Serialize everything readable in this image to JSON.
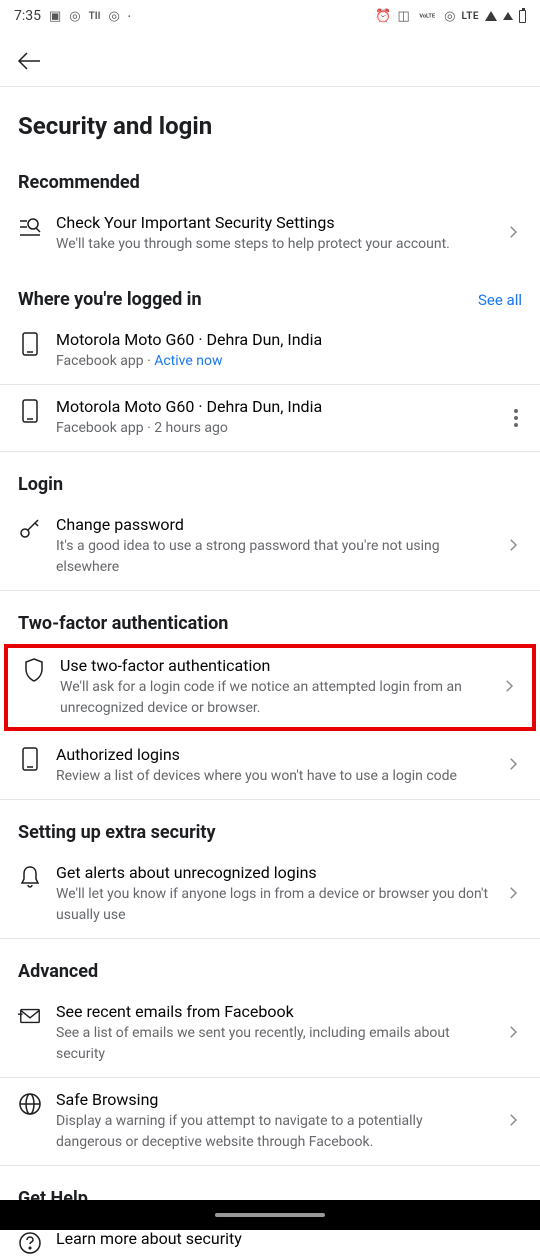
{
  "status": {
    "time": "7:35",
    "lte": "LTE",
    "volte": "VoLTE"
  },
  "header": {
    "title": "Security and login"
  },
  "sections": {
    "recommended": {
      "title": "Recommended",
      "item": {
        "title": "Check Your Important Security Settings",
        "subtitle": "We'll take you through some steps to help protect your account."
      }
    },
    "logged_in": {
      "title": "Where you're logged in",
      "see_all": "See all",
      "items": [
        {
          "title": "Motorola Moto G60 · Dehra Dun, India",
          "app": "Facebook app · ",
          "status": "Active now"
        },
        {
          "title": "Motorola Moto G60 · Dehra Dun, India",
          "subtitle": "Facebook app · 2 hours ago"
        }
      ]
    },
    "login": {
      "title": "Login",
      "item": {
        "title": "Change password",
        "subtitle": "It's a good idea to use a strong password that you're not using elsewhere"
      }
    },
    "two_factor": {
      "title": "Two-factor authentication",
      "items": [
        {
          "title": "Use two-factor authentication",
          "subtitle": "We'll ask for a login code if we notice an attempted login from an unrecognized device or browser."
        },
        {
          "title": "Authorized logins",
          "subtitle": "Review a list of devices where you won't have to use a login code"
        }
      ]
    },
    "extra_security": {
      "title": "Setting up extra security",
      "item": {
        "title": "Get alerts about unrecognized logins",
        "subtitle": "We'll let you know if anyone logs in from a device or browser you don't usually use"
      }
    },
    "advanced": {
      "title": "Advanced",
      "items": [
        {
          "title": "See recent emails from Facebook",
          "subtitle": "See a list of emails we sent you recently, including emails about security"
        },
        {
          "title": "Safe Browsing",
          "subtitle": "Display a warning if you attempt to navigate to a potentially dangerous or deceptive website through Facebook."
        }
      ]
    },
    "get_help": {
      "title": "Get Help",
      "item": {
        "title": "Learn more about security"
      }
    }
  }
}
